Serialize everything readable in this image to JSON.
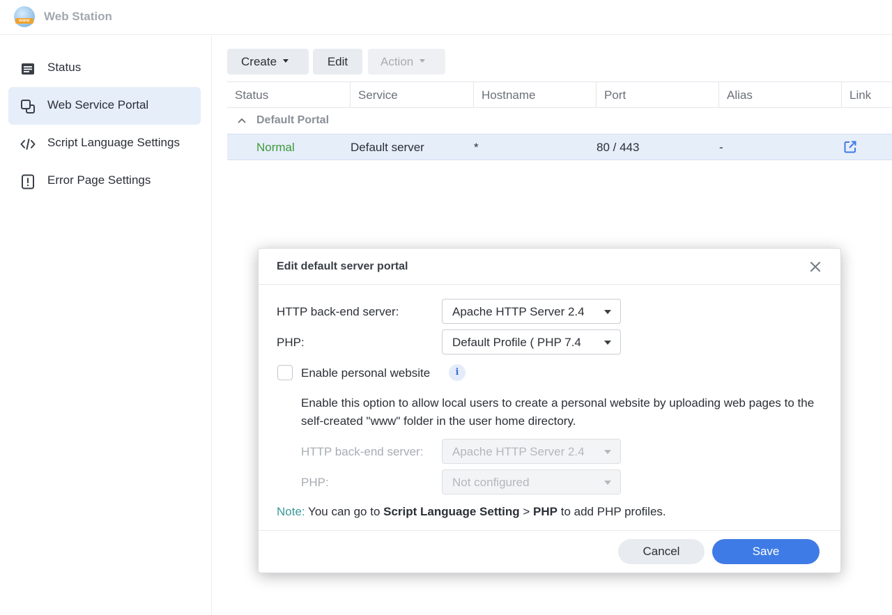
{
  "app": {
    "title": "Web Station",
    "logo_text": "www"
  },
  "sidebar": {
    "items": [
      {
        "label": "Status",
        "icon": "status-list-icon",
        "active": false
      },
      {
        "label": "Web Service Portal",
        "icon": "portal-windows-icon",
        "active": true
      },
      {
        "label": "Script Language Settings",
        "icon": "code-icon",
        "active": false
      },
      {
        "label": "Error Page Settings",
        "icon": "error-page-icon",
        "active": false
      }
    ]
  },
  "toolbar": {
    "create_label": "Create",
    "edit_label": "Edit",
    "action_label": "Action"
  },
  "table": {
    "columns": [
      "Status",
      "Service",
      "Hostname",
      "Port",
      "Alias",
      "Link"
    ],
    "group_label": "Default Portal",
    "rows": [
      {
        "status": "Normal",
        "service": "Default server",
        "hostname": "*",
        "port": "80 / 443",
        "alias": "-",
        "link_icon": "external-link-icon"
      }
    ]
  },
  "dialog": {
    "title": "Edit default server portal",
    "backend_label": "HTTP back-end server:",
    "backend_value": "Apache HTTP Server 2.4",
    "php_label": "PHP:",
    "php_value": "Default Profile ( PHP 7.4",
    "personal_label": "Enable personal website",
    "personal_checked": false,
    "personal_desc": "Enable this option to allow local users to create a personal website by uploading web pages to the self-created \"www\" folder in the user home directory.",
    "sub_backend_label": "HTTP back-end server:",
    "sub_backend_value": "Apache HTTP Server 2.4",
    "sub_php_label": "PHP:",
    "sub_php_value": "Not configured",
    "note_key": "Note:",
    "note_text_1": " You can go to ",
    "note_bold_1": "Script Language Setting",
    "note_text_2": " > ",
    "note_bold_2": "PHP",
    "note_text_3": " to add PHP profiles.",
    "cancel_label": "Cancel",
    "save_label": "Save"
  },
  "colors": {
    "accent": "#3f7be6",
    "status_normal": "#3f9a3a",
    "selected_row": "#e6eefa",
    "note_key": "#3b9a9a"
  }
}
